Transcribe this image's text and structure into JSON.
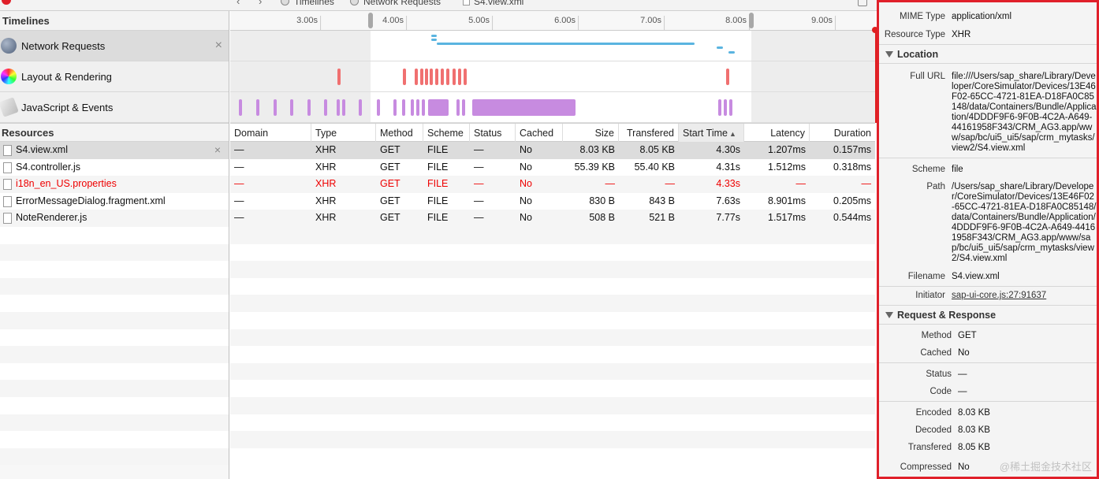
{
  "breadcrumbs": [
    "Timelines",
    "Network Requests",
    "S4.view.xml"
  ],
  "timelines": {
    "header": "Timelines",
    "items": [
      {
        "label": "Network Requests",
        "icon": "network-globe-icon"
      },
      {
        "label": "Layout & Rendering",
        "icon": "color-wheel-icon"
      },
      {
        "label": "JavaScript & Events",
        "icon": "script-scroll-icon"
      }
    ],
    "ruler_ticks": [
      "3.00s",
      "4.00s",
      "5.00s",
      "6.00s",
      "7.00s",
      "8.00s",
      "9.00s"
    ]
  },
  "resources": {
    "header": "Resources",
    "items": [
      {
        "label": "S4.view.xml"
      },
      {
        "label": "S4.controller.js"
      },
      {
        "label": "i18n_en_US.properties"
      },
      {
        "label": "ErrorMessageDialog.fragment.xml"
      },
      {
        "label": "NoteRenderer.js"
      }
    ]
  },
  "table": {
    "columns": [
      "Domain",
      "Type",
      "Method",
      "Scheme",
      "Status",
      "Cached",
      "Size",
      "Transfered",
      "Start Time",
      "Latency",
      "Duration"
    ],
    "rows": [
      {
        "domain": "—",
        "type": "XHR",
        "method": "GET",
        "scheme": "FILE",
        "status": "—",
        "cached": "No",
        "size": "8.03 KB",
        "transfered": "8.05 KB",
        "start": "4.30s",
        "latency": "1.207ms",
        "duration": "0.157ms"
      },
      {
        "domain": "—",
        "type": "XHR",
        "method": "GET",
        "scheme": "FILE",
        "status": "—",
        "cached": "No",
        "size": "55.39 KB",
        "transfered": "55.40 KB",
        "start": "4.31s",
        "latency": "1.512ms",
        "duration": "0.318ms"
      },
      {
        "domain": "—",
        "type": "XHR",
        "method": "GET",
        "scheme": "FILE",
        "status": "—",
        "cached": "No",
        "size": "—",
        "transfered": "—",
        "start": "4.33s",
        "latency": "—",
        "duration": "—"
      },
      {
        "domain": "—",
        "type": "XHR",
        "method": "GET",
        "scheme": "FILE",
        "status": "—",
        "cached": "No",
        "size": "830 B",
        "transfered": "843 B",
        "start": "7.63s",
        "latency": "8.901ms",
        "duration": "0.205ms"
      },
      {
        "domain": "—",
        "type": "XHR",
        "method": "GET",
        "scheme": "FILE",
        "status": "—",
        "cached": "No",
        "size": "508 B",
        "transfered": "521 B",
        "start": "7.77s",
        "latency": "1.517ms",
        "duration": "0.544ms"
      }
    ]
  },
  "details": {
    "mime_type": {
      "k": "MIME Type",
      "v": "application/xml"
    },
    "resource_type": {
      "k": "Resource Type",
      "v": "XHR"
    },
    "location_header": "Location",
    "full_url": {
      "k": "Full URL",
      "v": "file:///Users/sap_share/Library/Developer/CoreSimulator/Devices/13E46F02-65CC-4721-81EA-D18FA0C85148/data/Containers/Bundle/Application/4DDDF9F6-9F0B-4C2A-A649-44161958F343/CRM_AG3.app/www/sap/bc/ui5_ui5/sap/crm_mytasks/view2/S4.view.xml"
    },
    "scheme": {
      "k": "Scheme",
      "v": "file"
    },
    "path": {
      "k": "Path",
      "v": "/Users/sap_share/Library/Developer/CoreSimulator/Devices/13E46F02-65CC-4721-81EA-D18FA0C85148/data/Containers/Bundle/Application/4DDDF9F6-9F0B-4C2A-A649-44161958F343/CRM_AG3.app/www/sap/bc/ui5_ui5/sap/crm_mytasks/view2/S4.view.xml"
    },
    "filename": {
      "k": "Filename",
      "v": "S4.view.xml"
    },
    "initiator": {
      "k": "Initiator",
      "v": "sap-ui-core.js:27:91637"
    },
    "reqres_header": "Request & Response",
    "method": {
      "k": "Method",
      "v": "GET"
    },
    "cached": {
      "k": "Cached",
      "v": "No"
    },
    "status": {
      "k": "Status",
      "v": "—"
    },
    "code": {
      "k": "Code",
      "v": "—"
    },
    "encoded": {
      "k": "Encoded",
      "v": "8.03 KB"
    },
    "decoded": {
      "k": "Decoded",
      "v": "8.03 KB"
    },
    "transfered": {
      "k": "Transfered",
      "v": "8.05 KB"
    },
    "compressed": {
      "k": "Compressed",
      "v": "No"
    }
  },
  "watermark": "@稀土掘金技术社区",
  "colors": {
    "accent_red": "#e0202a",
    "network": "#5ab4e0",
    "layout": "#f07070",
    "script": "#c78be0"
  }
}
